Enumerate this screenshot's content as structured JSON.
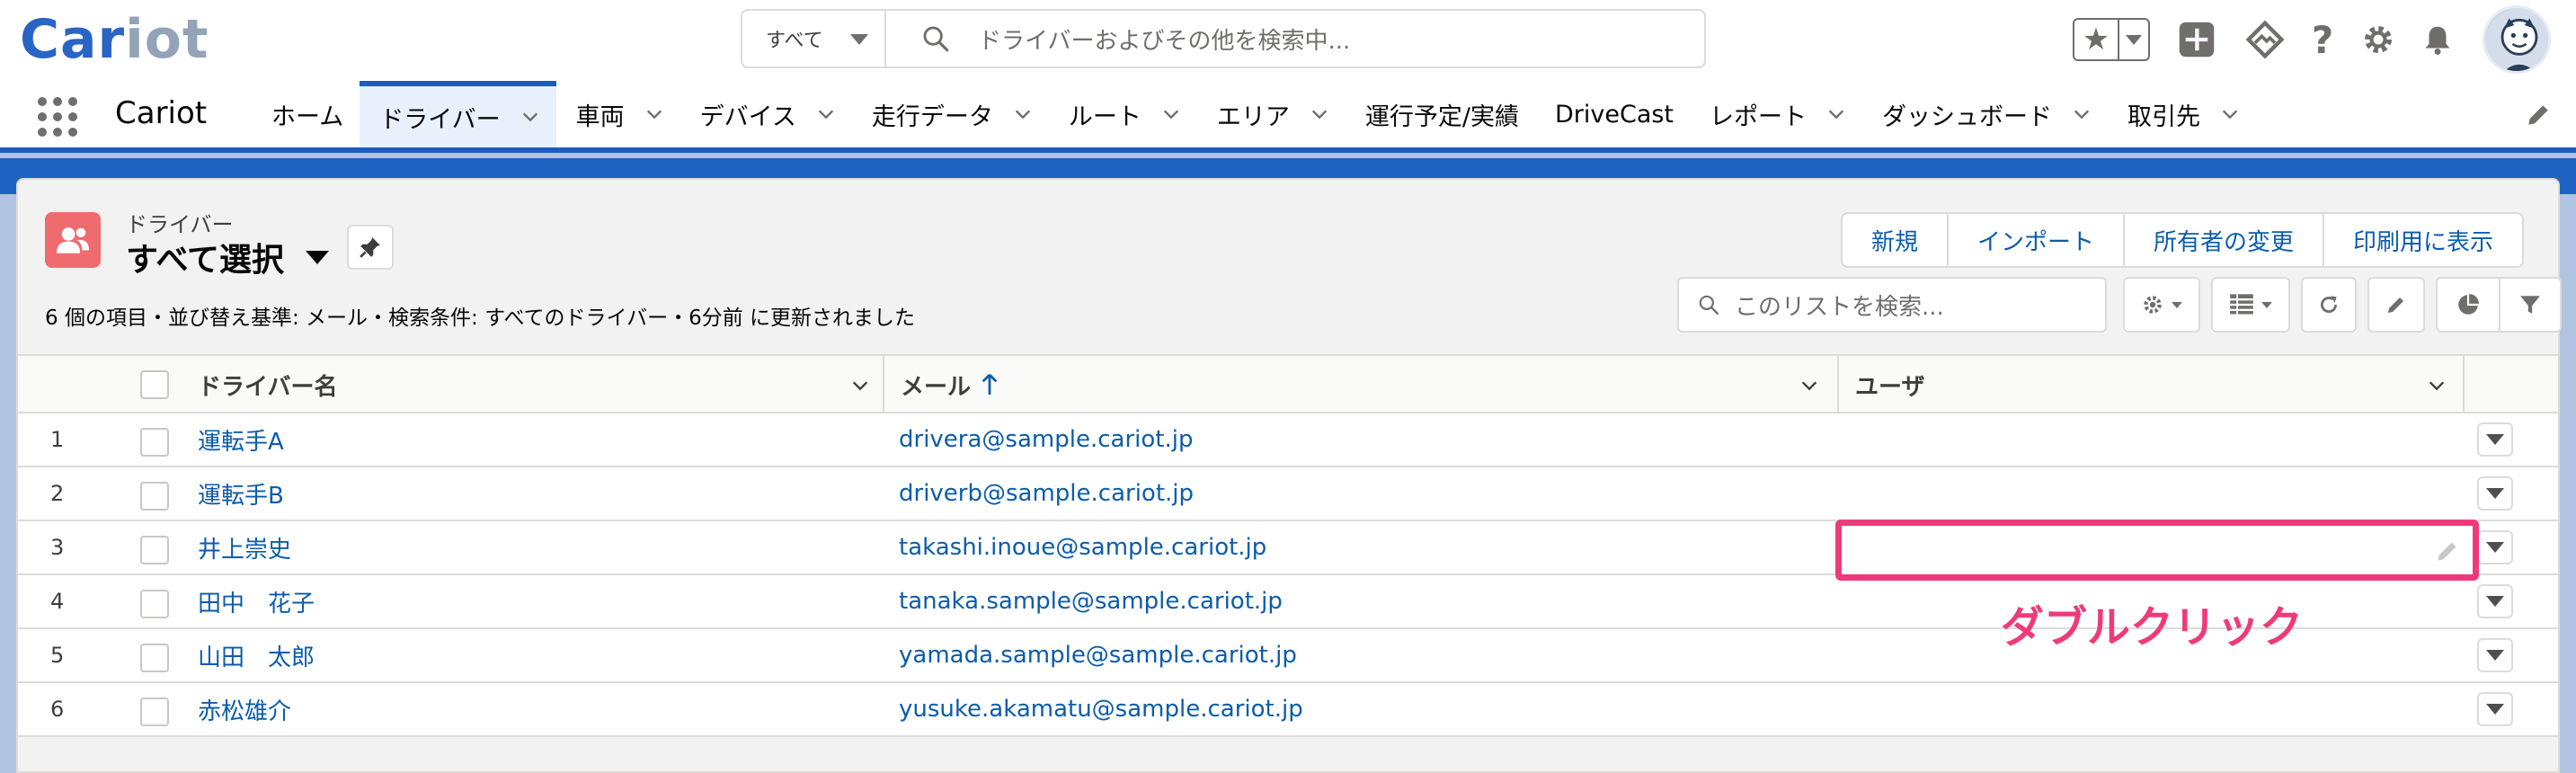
{
  "header": {
    "logo_part1": "Car",
    "logo_part2": "iot",
    "search_scope": "すべて",
    "search_placeholder": "ドライバーおよびその他を検索中..."
  },
  "icons": {
    "favorites": "star-icon",
    "add": "plus-icon",
    "trailhead": "trailhead-icon",
    "help": "question-icon",
    "setup": "gear-icon",
    "notifications": "bell-icon"
  },
  "nav": {
    "app_name": "Cariot",
    "items": [
      {
        "label": "ホーム",
        "chevron": false,
        "active": false
      },
      {
        "label": "ドライバー",
        "chevron": true,
        "active": true
      },
      {
        "label": "車両",
        "chevron": true,
        "active": false
      },
      {
        "label": "デバイス",
        "chevron": true,
        "active": false
      },
      {
        "label": "走行データ",
        "chevron": true,
        "active": false
      },
      {
        "label": "ルート",
        "chevron": true,
        "active": false
      },
      {
        "label": "エリア",
        "chevron": true,
        "active": false
      },
      {
        "label": "運行予定/実績",
        "chevron": false,
        "active": false
      },
      {
        "label": "DriveCast",
        "chevron": false,
        "active": false
      },
      {
        "label": "レポート",
        "chevron": true,
        "active": false
      },
      {
        "label": "ダッシュボード",
        "chevron": true,
        "active": false
      },
      {
        "label": "取引先",
        "chevron": true,
        "active": false
      }
    ]
  },
  "list_view": {
    "object_label": "ドライバー",
    "view_name": "すべて選択",
    "meta": "6 個の項目・並び替え基準: メール・検索条件: すべてのドライバー・6分前 に更新されました",
    "buttons": [
      "新規",
      "インポート",
      "所有者の変更",
      "印刷用に表示"
    ],
    "search_placeholder": "このリストを検索...",
    "columns": {
      "name": "ドライバー名",
      "email": "メール",
      "user": "ユーザ"
    },
    "rows": [
      {
        "num": "1",
        "name": "運転手A",
        "email": "drivera@sample.cariot.jp",
        "user": ""
      },
      {
        "num": "2",
        "name": "運転手B",
        "email": "driverb@sample.cariot.jp",
        "user": ""
      },
      {
        "num": "3",
        "name": "井上崇史",
        "email": "takashi.inoue@sample.cariot.jp",
        "user": ""
      },
      {
        "num": "4",
        "name": "田中　花子",
        "email": "tanaka.sample@sample.cariot.jp",
        "user": ""
      },
      {
        "num": "5",
        "name": "山田　太郎",
        "email": "yamada.sample@sample.cariot.jp",
        "user": ""
      },
      {
        "num": "6",
        "name": "赤松雄介",
        "email": "yusuke.akamatu@sample.cariot.jp",
        "user": ""
      }
    ]
  },
  "annotation": {
    "text": "ダブルクリック",
    "color": "#ef3a7a"
  },
  "colors": {
    "brand_blue": "#1b5dbd",
    "link_blue": "#0b5cab",
    "object_icon": "#f06b6e"
  }
}
